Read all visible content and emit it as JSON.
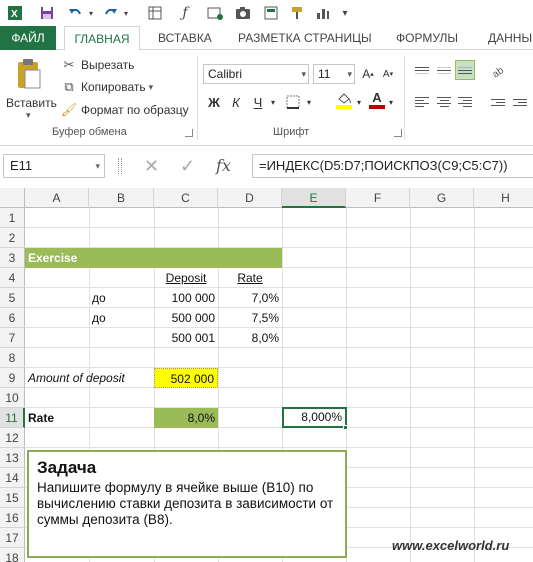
{
  "qat": {
    "icons": [
      "excel-icon",
      "save-icon",
      "undo-icon",
      "redo-icon",
      "new-sheet-icon",
      "fx-icon",
      "insert-function-icon",
      "camera-icon",
      "format-icon",
      "format-painter-icon",
      "chart-icon",
      "customize-icon"
    ]
  },
  "tabs": {
    "file": "ФАЙЛ",
    "home": "ГЛАВНАЯ",
    "insert": "ВСТАВКА",
    "page_layout": "РАЗМЕТКА СТРАНИЦЫ",
    "formulas": "ФОРМУЛЫ",
    "data": "ДАННЫ"
  },
  "clipboard": {
    "paste": "Вставить",
    "cut": "Вырезать",
    "copy": "Копировать",
    "format_painter": "Формат по образцу",
    "group_label": "Буфер обмена"
  },
  "font": {
    "name": "Calibri",
    "size": "11",
    "bold": "Ж",
    "italic": "К",
    "underline": "Ч",
    "group_label": "Шрифт",
    "fill_color": "#ffff00",
    "font_color": "#c00000"
  },
  "formula_bar": {
    "name_box": "E11",
    "cancel": "✕",
    "confirm": "✓",
    "fx": "fx",
    "formula": "=ИНДЕКС(D5:D7;ПОИСКПОЗ(C9;C5:C7))"
  },
  "grid": {
    "columns": [
      "A",
      "B",
      "C",
      "D",
      "E",
      "F",
      "G",
      "H"
    ],
    "selected_column": "E",
    "rows": [
      "1",
      "2",
      "3",
      "4",
      "5",
      "6",
      "7",
      "8",
      "9",
      "10",
      "11",
      "12",
      "13",
      "14",
      "15",
      "16",
      "17",
      "18"
    ],
    "selected_row": "11",
    "cells": {
      "A3": "Exercise",
      "C4": "Deposit",
      "D4": "Rate",
      "B5": "до",
      "C5": "100 000",
      "D5": "7,0%",
      "B6": "до",
      "C6": "500 000",
      "D6": "7,5%",
      "C7": "500 001",
      "D7": "8,0%",
      "A9": "Amount of deposit",
      "C9": "502 000",
      "A11": "Rate",
      "C11": "8,0%",
      "E11": "8,000%"
    },
    "colors": {
      "header_fill": "#9bbb59",
      "input_fill": "#ffff00",
      "result_fill": "#9bbb59",
      "selection": "#217346"
    }
  },
  "note": {
    "title": "Задача",
    "body": "Напишите формулу в ячейке выше  (B10) по вычислению ставки депозита в зависимости от суммы депозита (B8)."
  },
  "watermark": "www.excelworld.ru"
}
